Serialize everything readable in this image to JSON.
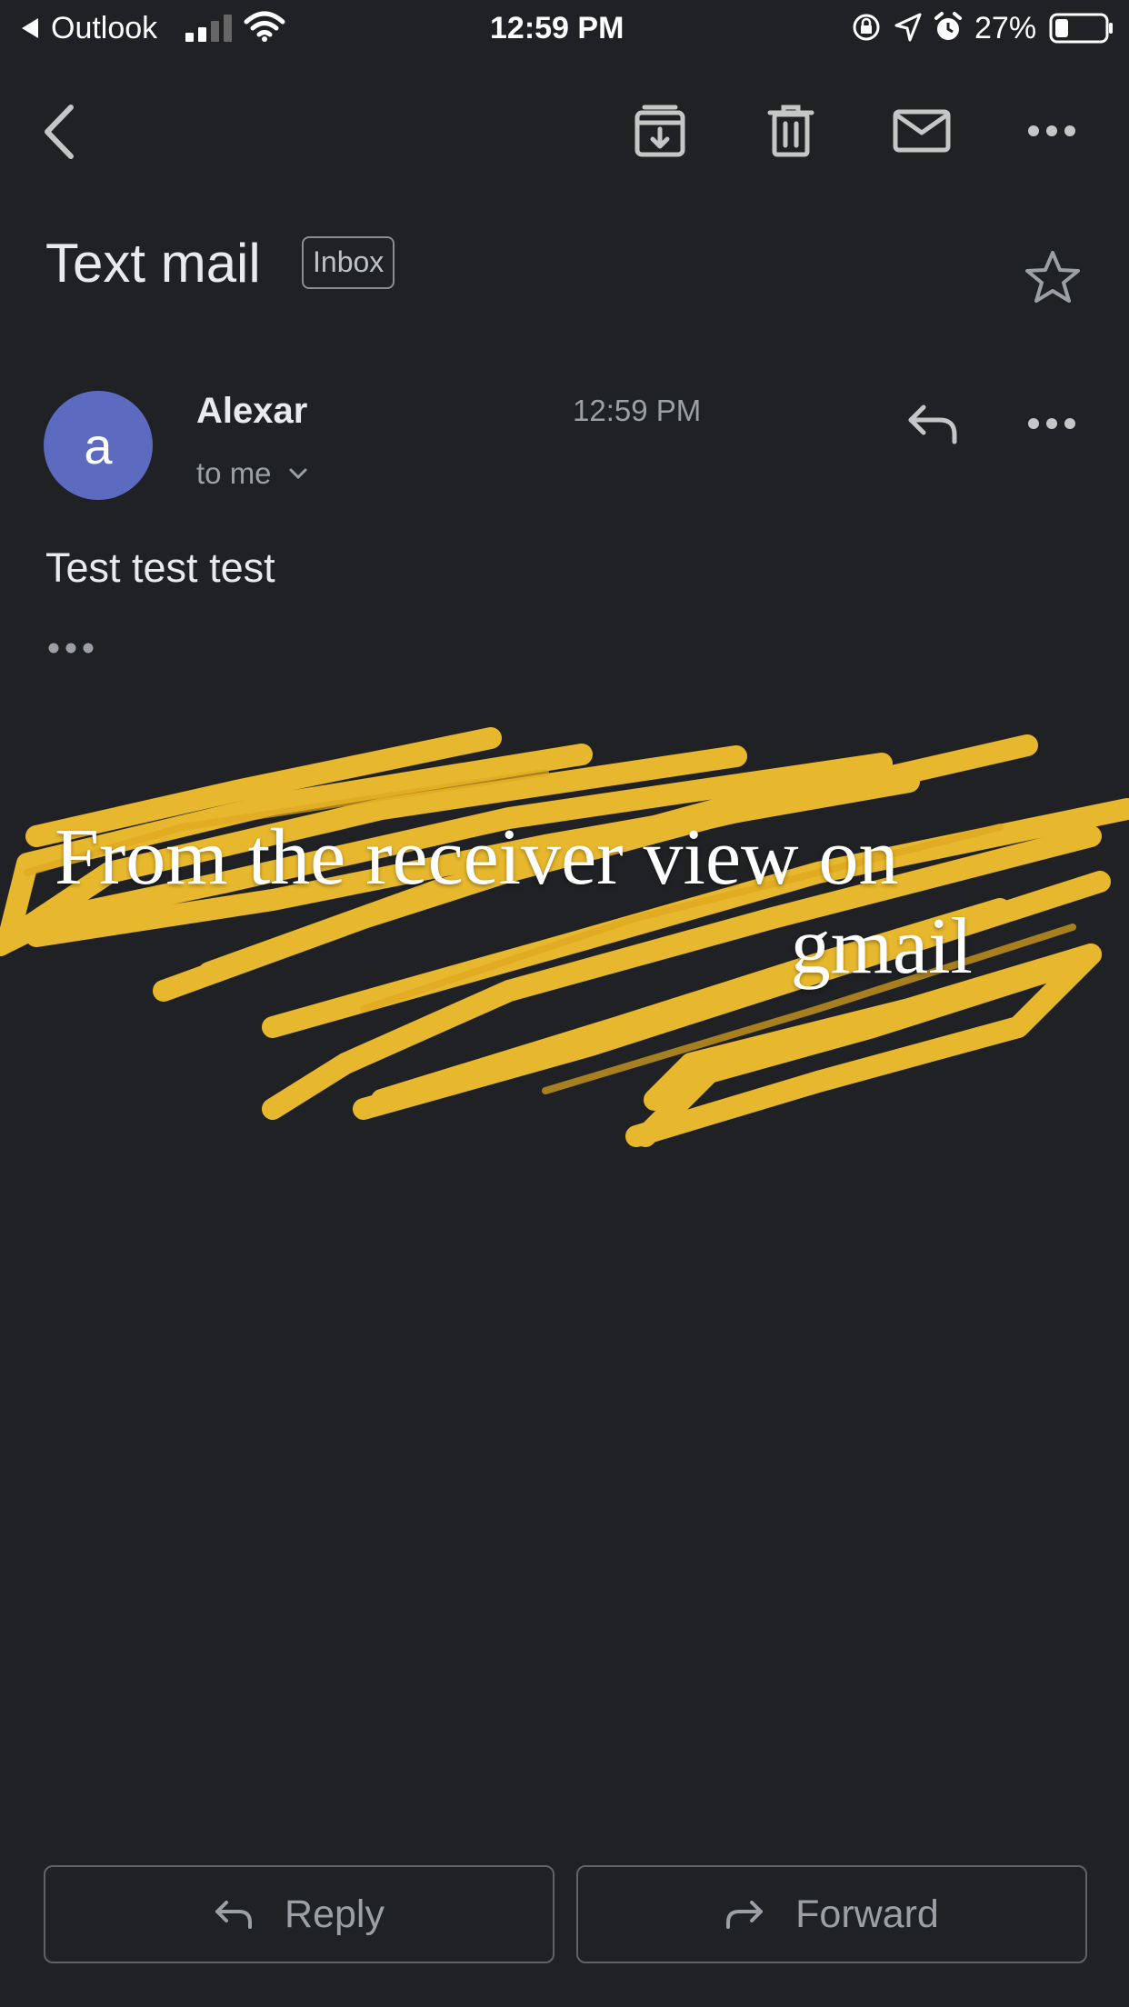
{
  "status_bar": {
    "back_app": "Outlook",
    "time": "12:59 PM",
    "battery": "27%"
  },
  "toolbar": {
    "icons": [
      "back-arrow-icon",
      "archive-icon",
      "trash-icon",
      "mail-icon",
      "more-icon"
    ]
  },
  "email": {
    "subject": "Text mail",
    "label": "Inbox",
    "sender_initial": "a",
    "sender_name": "Alexar",
    "recipient": "to me",
    "time": "12:59 PM",
    "body": "Test test test"
  },
  "actions": {
    "reply_label": "Reply",
    "forward_label": "Forward"
  },
  "overlay": {
    "line1": "From the receiver view on",
    "line2": "gmail",
    "scribble_color": "#F2C12E"
  },
  "colors": {
    "background": "#202124",
    "avatar": "#5c6bc0"
  }
}
